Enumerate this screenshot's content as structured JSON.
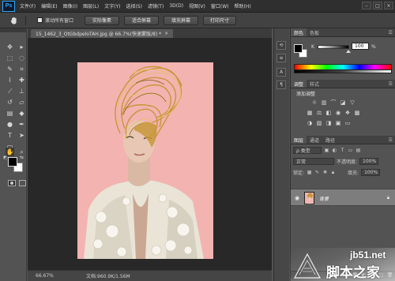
{
  "app": {
    "logo_text": "Ps"
  },
  "menu": [
    "文件(F)",
    "编辑(E)",
    "图像(I)",
    "图层(L)",
    "文字(Y)",
    "选择(S)",
    "滤镜(T)",
    "3D(D)",
    "视图(V)",
    "窗口(W)",
    "帮助(H)"
  ],
  "window_controls": [
    "–",
    "□",
    "×"
  ],
  "options_bar": {
    "scroll_all_label": "滚动所有窗口",
    "buttons": [
      "实际像素",
      "适合屏幕",
      "填充屏幕",
      "打印尺寸"
    ]
  },
  "document": {
    "tab_title": "15_1462_3_OtGbdpeloTAH.jpg @ 66.7%(快速蒙版/8) *",
    "tab_close": "×",
    "zoom": "66.67%",
    "doc_info": "文档:960.9K/1.56M"
  },
  "color_panel": {
    "tabs": [
      "颜色",
      "色板"
    ],
    "channel_label": "K",
    "channel_value": "100",
    "channel_unit": "%",
    "foreground": "#000000",
    "background": "#ffffff"
  },
  "adjustments_panel": {
    "tabs": [
      "调整",
      "样式"
    ],
    "title": "添加调整"
  },
  "layers_panel": {
    "tabs": [
      "图层",
      "通道",
      "路径"
    ],
    "filter_kind": "ρ 类型",
    "blend_mode": "正常",
    "opacity_label": "不透明度:",
    "opacity_value": "100%",
    "lock_label": "锁定:",
    "fill_label": "填充:",
    "fill_value": "100%",
    "layer_name": "背景"
  },
  "watermark": {
    "domain": "jb51.net",
    "name": "脚本之家"
  },
  "colors": {
    "photo_background": "#f3b3b1",
    "hair": "#c89a3a",
    "accent": "#31a8ff"
  }
}
